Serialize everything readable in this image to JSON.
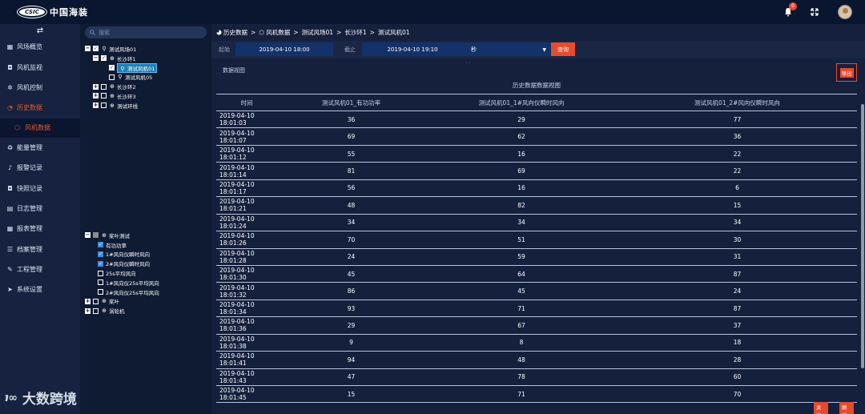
{
  "app": {
    "logo_badge": "CSIC",
    "logo_text": "中国海装",
    "notification_count": "0"
  },
  "sidebar": {
    "items": [
      {
        "label": "风场概览",
        "icon": "grid-icon"
      },
      {
        "label": "风机监视",
        "icon": "camera-icon"
      },
      {
        "label": "风机控制",
        "icon": "gear-icon"
      },
      {
        "label": "历史数据",
        "icon": "pie-icon",
        "active": true
      },
      {
        "label": "能量管理",
        "icon": "recycle-icon"
      },
      {
        "label": "报警记录",
        "icon": "bell-icon"
      },
      {
        "label": "快照记录",
        "icon": "camera-icon"
      },
      {
        "label": "日志管理",
        "icon": "log-icon"
      },
      {
        "label": "报表管理",
        "icon": "grid-icon"
      },
      {
        "label": "档案管理",
        "icon": "list-icon"
      },
      {
        "label": "工程管理",
        "icon": "wrench-icon"
      },
      {
        "label": "系统设置",
        "icon": "send-icon"
      }
    ],
    "sub_item": {
      "label": "风机数据"
    }
  },
  "tree": {
    "search_placeholder": "搜索",
    "nodes": [
      {
        "label": "测试风场01"
      },
      {
        "label": "长沙环1"
      },
      {
        "label": "测试风机01"
      },
      {
        "label": "测试风机05"
      },
      {
        "label": "长沙环2"
      },
      {
        "label": "长沙环3"
      },
      {
        "label": "测试环线"
      }
    ],
    "nodes2": [
      {
        "label": "桨叶测试"
      },
      {
        "label": "有功功率"
      },
      {
        "label": "1#风向仪瞬时风向"
      },
      {
        "label": "2#风向仪瞬时风向"
      },
      {
        "label": "25s平均风向"
      },
      {
        "label": "1#风向仪25s平均风向"
      },
      {
        "label": "2#风向仪25s平均风向"
      },
      {
        "label": "桨叶"
      },
      {
        "label": "涡轮机"
      }
    ]
  },
  "breadcrumb": [
    "历史数据",
    "风机数据",
    "测试风场01",
    "长沙环1",
    "测试风机01"
  ],
  "query": {
    "start_label": "起始",
    "start_value": "2019-04-10 18:00",
    "end_label": "截止",
    "end_value": "2019-04-10 19:10",
    "unit_value": "秒",
    "query_button": "查询"
  },
  "section_title": "数据视图",
  "export_button": "导出",
  "table": {
    "caption": "历史数据数据视图",
    "headers": [
      "时间",
      "测试风机01_有功功率",
      "测试风机01_1#风向仪瞬时风向",
      "测试风机01_2#风向仪瞬时风向"
    ],
    "rows": [
      [
        "2019-04-10 18:01:03",
        "36",
        "29",
        "77"
      ],
      [
        "2019-04-10 18:01:07",
        "69",
        "62",
        "36"
      ],
      [
        "2019-04-10 18:01:12",
        "55",
        "16",
        "22"
      ],
      [
        "2019-04-10 18:01:14",
        "81",
        "69",
        "22"
      ],
      [
        "2019-04-10 18:01:17",
        "56",
        "16",
        "6"
      ],
      [
        "2019-04-10 18:01:21",
        "48",
        "82",
        "15"
      ],
      [
        "2019-04-10 18:01:24",
        "34",
        "34",
        "34"
      ],
      [
        "2019-04-10 18:01:26",
        "70",
        "51",
        "30"
      ],
      [
        "2019-04-10 18:01:28",
        "24",
        "59",
        "31"
      ],
      [
        "2019-04-10 18:01:30",
        "45",
        "64",
        "87"
      ],
      [
        "2019-04-10 18:01:32",
        "86",
        "45",
        "24"
      ],
      [
        "2019-04-10 18:01:34",
        "93",
        "71",
        "87"
      ],
      [
        "2019-04-10 18:01:36",
        "29",
        "67",
        "37"
      ],
      [
        "2019-04-10 18:01:38",
        "9",
        "8",
        "18"
      ],
      [
        "2019-04-10 18:01:41",
        "94",
        "48",
        "28"
      ],
      [
        "2019-04-10 18:01:43",
        "47",
        "78",
        "60"
      ],
      [
        "2019-04-10 18:01:45",
        "15",
        "71",
        "70"
      ]
    ]
  },
  "footer": {
    "close_button": "关闭",
    "refresh_button": "刷新"
  },
  "watermark": {
    "text": "大数跨境"
  },
  "colors": {
    "accent": "#e84a2e",
    "bg": "#15203d",
    "sidebar": "#16223f"
  }
}
